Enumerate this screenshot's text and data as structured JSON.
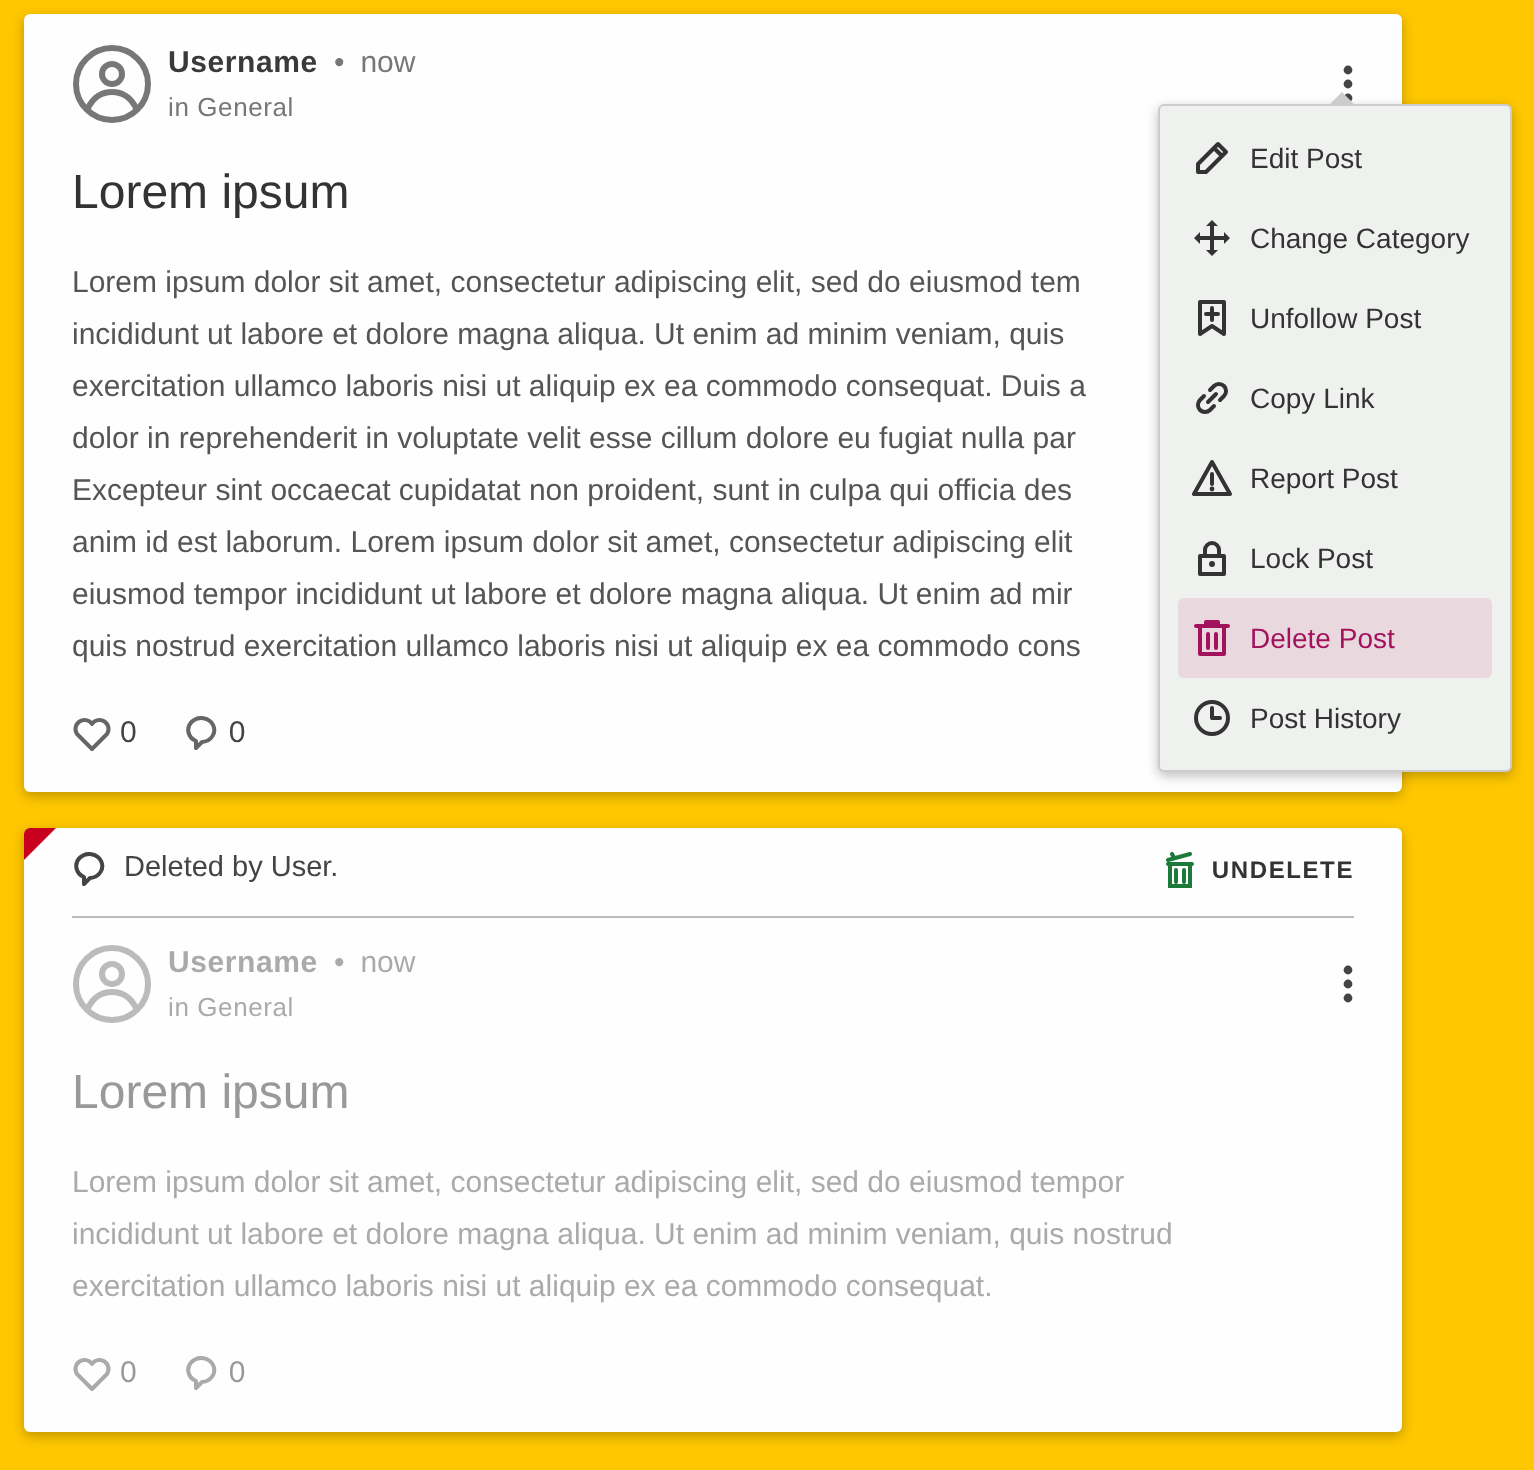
{
  "posts": [
    {
      "deleted": false,
      "author": "Username",
      "separator": "•",
      "time": "now",
      "category": "in General",
      "title": "Lorem ipsum",
      "body_lines": [
        "Lorem ipsum dolor sit amet, consectetur adipiscing elit, sed do eiusmod tem",
        "incididunt ut labore et dolore magna aliqua. Ut enim ad minim veniam, quis",
        "exercitation ullamco laboris nisi ut aliquip ex ea commodo consequat. Duis a",
        "dolor in reprehenderit in voluptate velit esse cillum dolore eu fugiat nulla par",
        "Excepteur sint occaecat cupidatat non proident, sunt in culpa qui officia des",
        "anim id est laborum. Lorem ipsum dolor sit amet, consectetur adipiscing elit",
        "eiusmod tempor incididunt ut labore et dolore magna aliqua. Ut enim ad mir",
        "quis nostrud exercitation ullamco laboris nisi ut aliquip ex ea commodo cons"
      ],
      "likes": "0",
      "comments": "0",
      "menu": {
        "items": [
          {
            "kind": "edit",
            "label": "Edit Post",
            "selected": false
          },
          {
            "kind": "move",
            "label": "Change Category",
            "selected": false
          },
          {
            "kind": "bookmark",
            "label": "Unfollow Post",
            "selected": false
          },
          {
            "kind": "link",
            "label": "Copy Link",
            "selected": false
          },
          {
            "kind": "warning",
            "label": "Report Post",
            "selected": false
          },
          {
            "kind": "lock",
            "label": "Lock Post",
            "selected": false
          },
          {
            "kind": "trash",
            "label": "Delete Post",
            "selected": true
          },
          {
            "kind": "history",
            "label": "Post History",
            "selected": false
          }
        ]
      }
    },
    {
      "deleted": true,
      "deleted_note": "Deleted by User.",
      "undelete_label": "UNDELETE",
      "author": "Username",
      "separator": "•",
      "time": "now",
      "category": "in General",
      "title": "Lorem ipsum",
      "body_lines": [
        "Lorem ipsum dolor sit amet, consectetur adipiscing elit, sed do eiusmod tempor",
        "incididunt ut labore et dolore magna aliqua. Ut enim ad minim veniam, quis nostrud",
        "exercitation ullamco laboris nisi ut aliquip ex ea commodo consequat."
      ],
      "likes": "0",
      "comments": "0"
    }
  ]
}
